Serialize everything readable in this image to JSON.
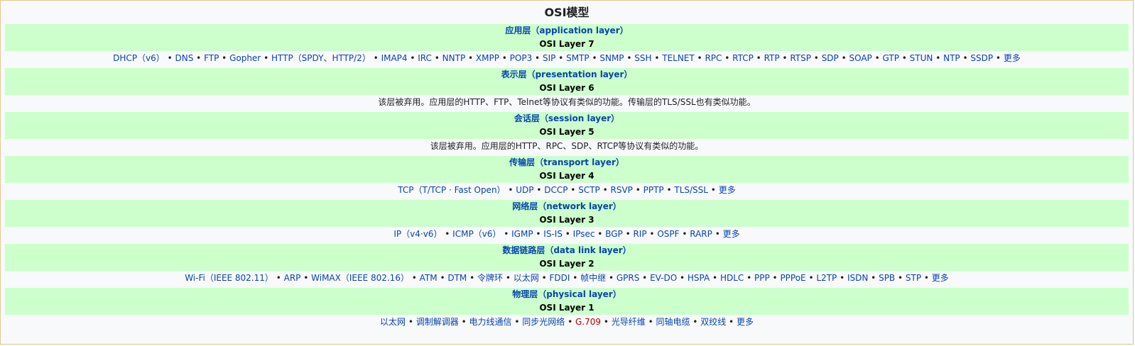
{
  "title": "OSI模型",
  "colors": {
    "header_bg": "#ccffcc",
    "link": "#0645ad",
    "redlink": "#ba0000",
    "border": "#e6c98f"
  },
  "layers": [
    {
      "name": "应用层（application layer）",
      "num": "OSI Layer 7",
      "items": [
        {
          "t": "DHCP（v6）"
        },
        {
          "t": "DNS"
        },
        {
          "t": "FTP"
        },
        {
          "t": "Gopher"
        },
        {
          "t": "HTTP（SPDY、HTTP/2）"
        },
        {
          "t": "IMAP4"
        },
        {
          "t": "IRC"
        },
        {
          "t": "NNTP"
        },
        {
          "t": "XMPP"
        },
        {
          "t": "POP3"
        },
        {
          "t": "SIP"
        },
        {
          "t": "SMTP"
        },
        {
          "t": "SNMP"
        },
        {
          "t": "SSH"
        },
        {
          "t": "TELNET"
        },
        {
          "t": "RPC"
        },
        {
          "t": "RTCP"
        },
        {
          "t": "RTP"
        },
        {
          "t": "RTSP"
        },
        {
          "t": "SDP"
        },
        {
          "t": "SOAP"
        },
        {
          "t": "GTP"
        },
        {
          "t": "STUN"
        },
        {
          "t": "NTP"
        },
        {
          "t": "SSDP"
        },
        {
          "t": "更多"
        }
      ]
    },
    {
      "name": "表示层（presentation layer）",
      "num": "OSI Layer 6",
      "text": "该层被弃用。应用层的HTTP、FTP、Telnet等协议有类似的功能。传输层的TLS/SSL也有类似功能。"
    },
    {
      "name": "会话层（session layer）",
      "num": "OSI Layer 5",
      "text": "该层被弃用。应用层的HTTP、RPC、SDP、RTCP等协议有类似的功能。"
    },
    {
      "name": "传输层（transport layer）",
      "num": "OSI Layer 4",
      "items": [
        {
          "t": "TCP（T/TCP · Fast Open）"
        },
        {
          "t": "UDP"
        },
        {
          "t": "DCCP"
        },
        {
          "t": "SCTP"
        },
        {
          "t": "RSVP"
        },
        {
          "t": "PPTP"
        },
        {
          "t": "TLS/SSL"
        },
        {
          "t": "更多"
        }
      ]
    },
    {
      "name": "网络层（network layer）",
      "num": "OSI Layer 3",
      "items": [
        {
          "t": "IP（v4·v6）"
        },
        {
          "t": "ICMP（v6）"
        },
        {
          "t": "IGMP"
        },
        {
          "t": "IS-IS"
        },
        {
          "t": "IPsec"
        },
        {
          "t": "BGP"
        },
        {
          "t": "RIP"
        },
        {
          "t": "OSPF"
        },
        {
          "t": "RARP"
        },
        {
          "t": "更多"
        }
      ]
    },
    {
      "name": "数据链路层（data link layer）",
      "num": "OSI Layer 2",
      "items": [
        {
          "t": "Wi-Fi（IEEE 802.11）"
        },
        {
          "t": "ARP"
        },
        {
          "t": "WiMAX（IEEE 802.16）"
        },
        {
          "t": "ATM"
        },
        {
          "t": "DTM"
        },
        {
          "t": "令牌环"
        },
        {
          "t": "以太网"
        },
        {
          "t": "FDDI"
        },
        {
          "t": "帧中继"
        },
        {
          "t": "GPRS"
        },
        {
          "t": "EV-DO"
        },
        {
          "t": "HSPA"
        },
        {
          "t": "HDLC"
        },
        {
          "t": "PPP"
        },
        {
          "t": "PPPoE"
        },
        {
          "t": "L2TP"
        },
        {
          "t": "ISDN"
        },
        {
          "t": "SPB"
        },
        {
          "t": "STP"
        },
        {
          "t": "更多"
        }
      ]
    },
    {
      "name": "物理层（physical layer）",
      "num": "OSI Layer 1",
      "items": [
        {
          "t": "以太网"
        },
        {
          "t": "调制解调器"
        },
        {
          "t": "电力线通信"
        },
        {
          "t": "同步光网络"
        },
        {
          "t": "G.709",
          "red": true
        },
        {
          "t": "光导纤维"
        },
        {
          "t": "同轴电缆"
        },
        {
          "t": "双绞线"
        },
        {
          "t": "更多"
        }
      ]
    }
  ]
}
